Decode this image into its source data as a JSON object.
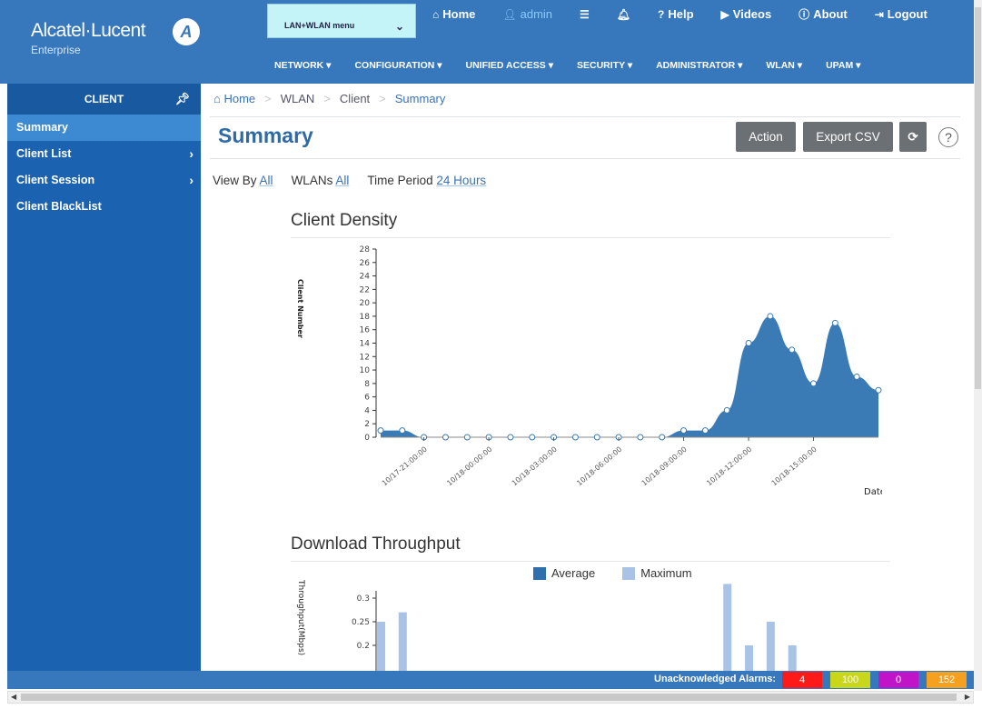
{
  "header": {
    "brand": "Alcatel·Lucent",
    "brand_sub": "Enterprise",
    "menu_select": "LAN+WLAN menu",
    "top_nav": [
      {
        "label": "Home",
        "icon": "home-icon"
      },
      {
        "label": "admin",
        "icon": "user-icon"
      },
      {
        "label": "",
        "icon": "list-icon"
      },
      {
        "label": "",
        "icon": "bell-icon"
      },
      {
        "label": "Help",
        "icon": "question-icon"
      },
      {
        "label": "Videos",
        "icon": "video-icon"
      },
      {
        "label": "About",
        "icon": "info-icon"
      },
      {
        "label": "Logout",
        "icon": "logout-icon"
      }
    ],
    "main_nav": [
      "NETWORK ▾",
      "CONFIGURATION ▾",
      "UNIFIED ACCESS ▾",
      "SECURITY ▾",
      "ADMINISTRATOR ▾",
      "WLAN ▾",
      "UPAM ▾"
    ]
  },
  "sidebar": {
    "title": "CLIENT",
    "items": [
      {
        "label": "Summary",
        "active": true,
        "arrow": false
      },
      {
        "label": "Client List",
        "active": false,
        "arrow": true
      },
      {
        "label": "Client Session",
        "active": false,
        "arrow": true
      },
      {
        "label": "Client BlackList",
        "active": false,
        "arrow": false
      }
    ]
  },
  "breadcrumb": [
    "Home",
    "WLAN",
    "Client",
    "Summary"
  ],
  "page_title": "Summary",
  "buttons": {
    "action": "Action",
    "export": "Export CSV",
    "refresh": "⟳",
    "help": "?"
  },
  "filters": {
    "view_by_label": "View By",
    "view_by_value": "All",
    "wlans_label": "WLANs",
    "wlans_value": "All",
    "period_label": "Time Period",
    "period_value": "24 Hours"
  },
  "chart_data": [
    {
      "type": "area",
      "title": "Client Density",
      "xlabel": "Date",
      "ylabel": "Client Number",
      "ylim": [
        0,
        28
      ],
      "yticks": [
        0,
        2,
        4,
        6,
        8,
        10,
        12,
        14,
        16,
        18,
        20,
        22,
        24,
        26,
        28
      ],
      "xtick_labels": [
        "10/17-21:00:00",
        "10/18-00:00:00",
        "10/18-03:00:00",
        "10/18-06:00:00",
        "10/18-09:00:00",
        "10/18-12:00:00",
        "10/18-15:00:00"
      ],
      "x": [
        "10/17-19:00:00",
        "10/17-20:00:00",
        "10/17-21:00:00",
        "10/17-22:00:00",
        "10/17-23:00:00",
        "10/18-00:00:00",
        "10/18-01:00:00",
        "10/18-02:00:00",
        "10/18-03:00:00",
        "10/18-04:00:00",
        "10/18-05:00:00",
        "10/18-06:00:00",
        "10/18-07:00:00",
        "10/18-08:00:00",
        "10/18-09:00:00",
        "10/18-10:00:00",
        "10/18-11:00:00",
        "10/18-12:00:00",
        "10/18-13:00:00",
        "10/18-14:00:00",
        "10/18-15:00:00",
        "10/18-16:00:00",
        "10/18-17:00:00"
      ],
      "values": [
        1,
        1,
        0,
        0,
        0,
        0,
        0,
        0,
        0,
        0,
        0,
        0,
        0,
        0,
        1,
        1,
        4,
        14,
        18,
        13,
        8,
        17,
        9,
        7
      ]
    },
    {
      "type": "bar",
      "title": "Download Throughput",
      "ylabel": "Throughput(Mbps)",
      "yticks": [
        0.2,
        0.25,
        0.3
      ],
      "series": [
        {
          "name": "Average",
          "color": "#2f6fae"
        },
        {
          "name": "Maximum",
          "color": "#a9c3e6"
        }
      ],
      "visible_max_bars": [
        {
          "x": "10/17-19:00:00",
          "value": 0.25
        },
        {
          "x": "10/17-20:00:00",
          "value": 0.27
        },
        {
          "x": "10/18-11:00:00",
          "value": 0.33
        },
        {
          "x": "10/18-12:00:00",
          "value": 0.2
        },
        {
          "x": "10/18-13:00:00",
          "value": 0.25
        },
        {
          "x": "10/18-14:00:00",
          "value": 0.2
        }
      ]
    }
  ],
  "alarms": {
    "label": "Unacknowledged Alarms:",
    "counts": [
      {
        "value": "4",
        "color": "#ff1a1a"
      },
      {
        "value": "100",
        "color": "#c9d61a"
      },
      {
        "value": "0",
        "color": "#c114c9"
      },
      {
        "value": "152",
        "color": "#f6a01f"
      }
    ]
  }
}
